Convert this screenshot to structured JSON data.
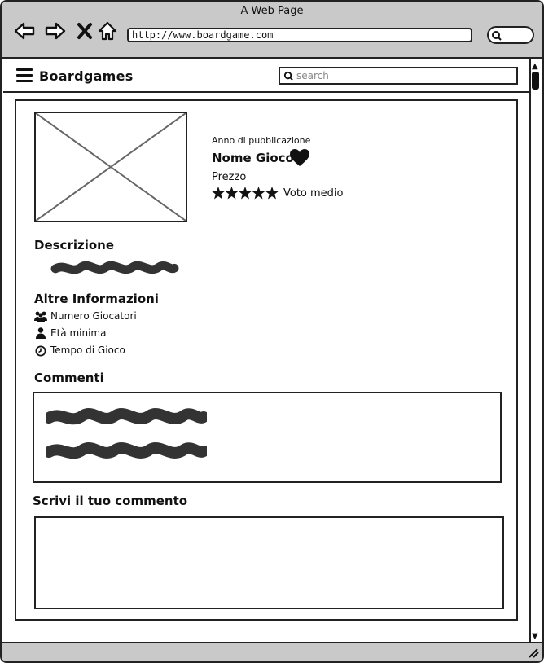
{
  "browser": {
    "window_title": "A Web Page",
    "url": "http://www.boardgame.com"
  },
  "app": {
    "brand": "Boardgames",
    "search_placeholder": "search"
  },
  "game": {
    "year_label": "Anno di pubblicazione",
    "name": "Nome Gioco",
    "price_label": "Prezzo",
    "rating_label": "Voto medio",
    "rating_stars": 5
  },
  "sections": {
    "description_heading": "Descrizione",
    "other_info_heading": "Altre Informazioni",
    "comments_heading": "Commenti",
    "write_comment_heading": "Scrivi il tuo commento"
  },
  "info_items": [
    {
      "icon": "players-icon",
      "label": "Numero Giocatori"
    },
    {
      "icon": "user-icon",
      "label": "Età minima"
    },
    {
      "icon": "clock-icon",
      "label": "Tempo di Gioco"
    }
  ]
}
